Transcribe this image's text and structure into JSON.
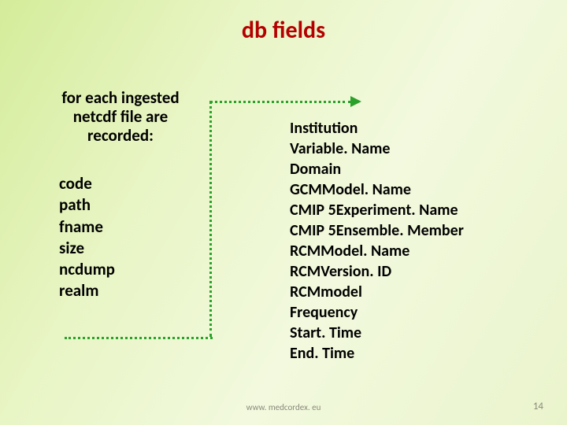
{
  "title": "db fields",
  "subhead": "for each ingested netcdf file are recorded:",
  "left_list": {
    "i0": "code",
    "i1": "path",
    "i2": "fname",
    "i3": "size",
    "i4": "ncdump",
    "i5": "realm"
  },
  "right_list": {
    "i0": "Institution",
    "i1": "Variable. Name",
    "i2": "Domain",
    "i3": "GCMModel. Name",
    "i4": "CMIP 5Experiment. Name",
    "i5": "CMIP 5Ensemble. Member",
    "i6": "RCMModel. Name",
    "i7": "RCMVersion. ID",
    "i8": "RCMmodel",
    "i9": "Frequency",
    "i10": "Start. Time",
    "i11": "End. Time"
  },
  "footer_url": "www. medcordex. eu",
  "page_num": "14"
}
